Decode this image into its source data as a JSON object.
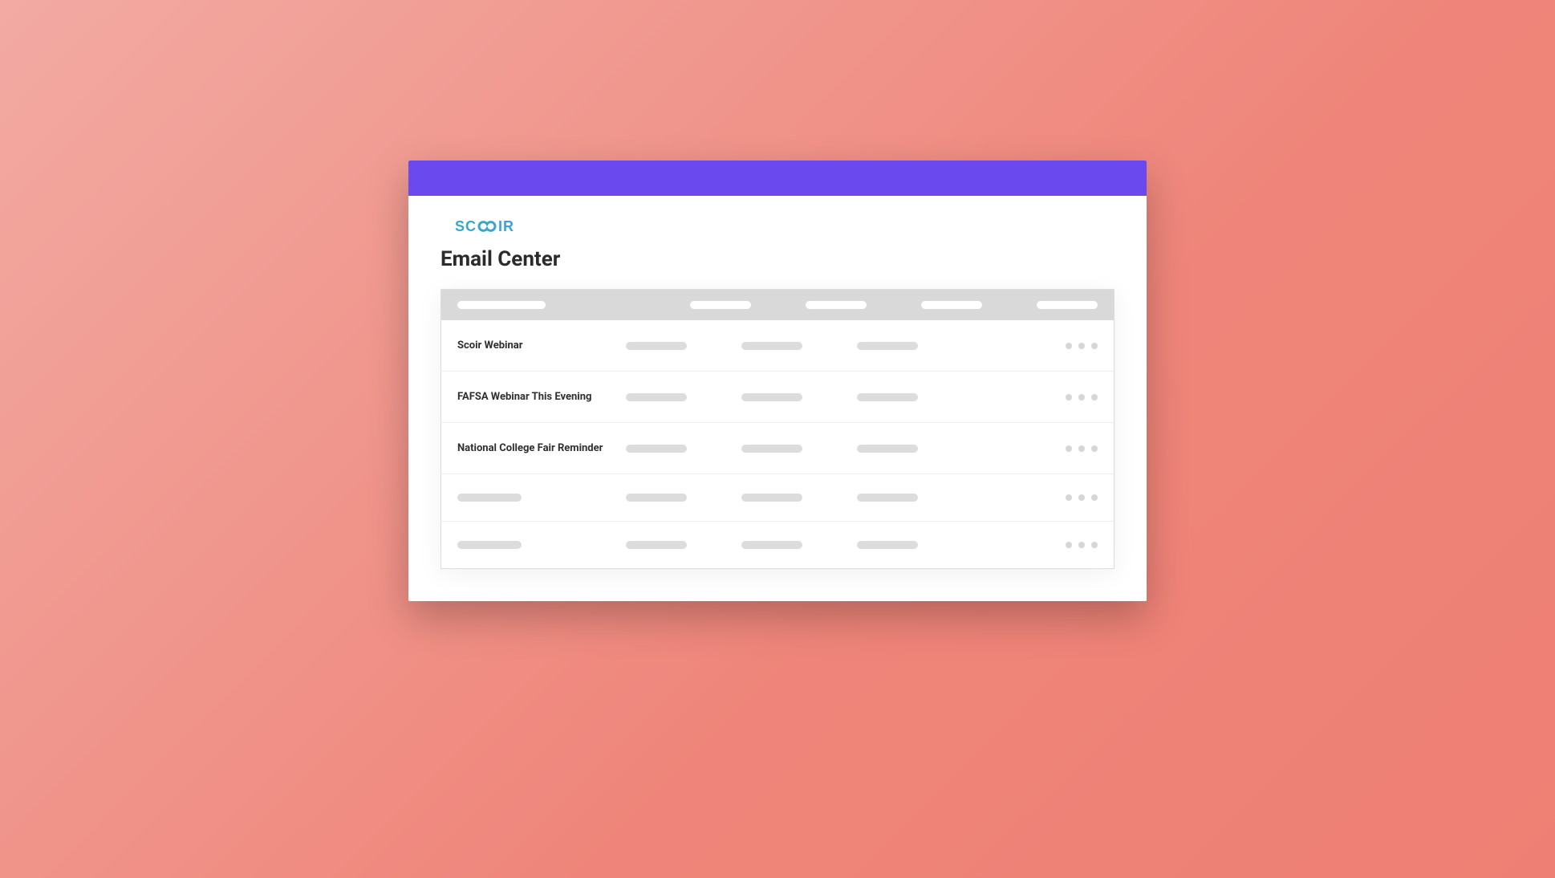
{
  "brand": {
    "name": "SCOIR"
  },
  "page": {
    "title": "Email Center"
  },
  "table": {
    "rows": [
      {
        "title": "Scoir Webinar",
        "has_title": true
      },
      {
        "title": "FAFSA Webinar This Evening",
        "has_title": true
      },
      {
        "title": "National College Fair Reminder",
        "has_title": true
      },
      {
        "title": "",
        "has_title": false
      },
      {
        "title": "",
        "has_title": false
      }
    ]
  }
}
